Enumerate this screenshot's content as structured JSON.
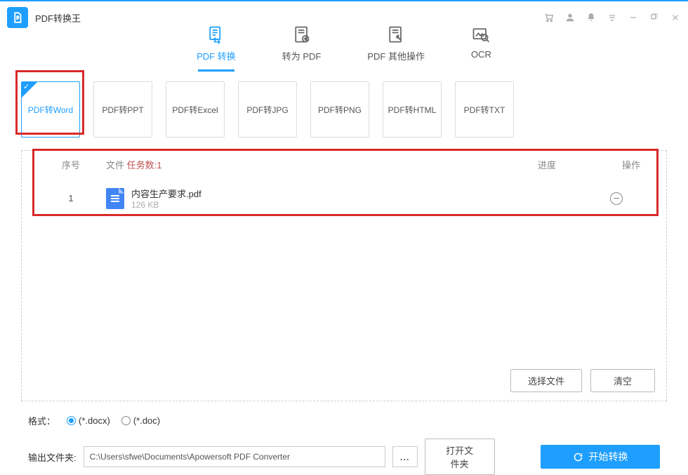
{
  "app": {
    "title": "PDF转换王"
  },
  "mainTabs": [
    {
      "label": "PDF 转换"
    },
    {
      "label": "转为 PDF"
    },
    {
      "label": "PDF 其他操作"
    },
    {
      "label": "OCR"
    }
  ],
  "formats": [
    {
      "label": "PDF转Word"
    },
    {
      "label": "PDF转PPT"
    },
    {
      "label": "PDF转Excel"
    },
    {
      "label": "PDF转JPG"
    },
    {
      "label": "PDF转PNG"
    },
    {
      "label": "PDF转HTML"
    },
    {
      "label": "PDF转TXT"
    }
  ],
  "table": {
    "headers": {
      "no": "序号",
      "file": "文件",
      "taskCount": "任务数:1",
      "progress": "进度",
      "action": "操作"
    },
    "rows": [
      {
        "no": "1",
        "name": "内容生产要求.pdf",
        "size": "126 KB"
      }
    ]
  },
  "buttons": {
    "selectFile": "选择文件",
    "clear": "清空",
    "openFolder": "打开文件夹",
    "start": "开始转换"
  },
  "footer": {
    "formatLabel": "格式：",
    "docx": "(*.docx)",
    "doc": "(*.doc)",
    "outputLabel": "输出文件夹:",
    "outputPath": "C:\\Users\\sfwe\\Documents\\Apowersoft PDF Converter",
    "browse": "..."
  }
}
